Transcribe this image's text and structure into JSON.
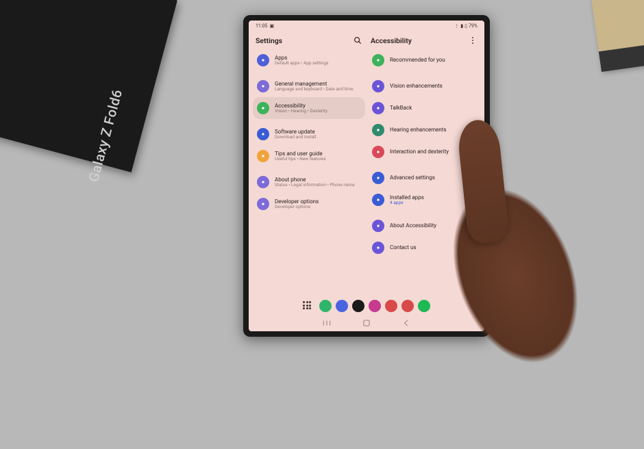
{
  "product_box_label": "Galaxy Z Fold6",
  "status": {
    "time": "11:05",
    "battery": "79%"
  },
  "left": {
    "title": "Settings",
    "items": [
      {
        "key": "apps",
        "title": "Apps",
        "sub": "Default apps • App settings",
        "color": "#4e5fd8"
      },
      {
        "key": "general",
        "title": "General management",
        "sub": "Language and keyboard • Date and time",
        "color": "#7c6bd8"
      },
      {
        "key": "accessibility",
        "title": "Accessibility",
        "sub": "Vision • Hearing • Dexterity",
        "color": "#3cb35a",
        "selected": true
      },
      {
        "key": "software-update",
        "title": "Software update",
        "sub": "Download and install",
        "color": "#3a5cd6"
      },
      {
        "key": "tips",
        "title": "Tips and user guide",
        "sub": "Useful tips • New features",
        "color": "#f0a33a"
      },
      {
        "key": "about",
        "title": "About phone",
        "sub": "Status • Legal information • Phone name",
        "color": "#7c6bd8"
      },
      {
        "key": "developer",
        "title": "Developer options",
        "sub": "Developer options",
        "color": "#7c6bd8"
      }
    ]
  },
  "right": {
    "title": "Accessibility",
    "items": [
      {
        "key": "recommended",
        "title": "Recommended for you",
        "color": "#3cb35a"
      },
      {
        "key": "vision",
        "title": "Vision enhancements",
        "color": "#6a55d8"
      },
      {
        "key": "talkback",
        "title": "TalkBack",
        "color": "#6a55d8"
      },
      {
        "key": "hearing",
        "title": "Hearing enhancements",
        "color": "#2e8b6e"
      },
      {
        "key": "interaction",
        "title": "Interaction and dexterity",
        "color": "#d84a5a"
      },
      {
        "key": "advanced",
        "title": "Advanced settings",
        "color": "#3a5cd6"
      },
      {
        "key": "installed",
        "title": "Installed apps",
        "link": "4 apps",
        "color": "#3a5cd6"
      },
      {
        "key": "about-a11y",
        "title": "About Accessibility",
        "color": "#6a55d8"
      },
      {
        "key": "contact",
        "title": "Contact us",
        "color": "#6a55d8"
      }
    ]
  },
  "dock_colors": [
    "#2fb56a",
    "#4a63e0",
    "#1a1a1a",
    "#c63a8f",
    "#d84a4a",
    "#d84a4a",
    "#1db954"
  ]
}
